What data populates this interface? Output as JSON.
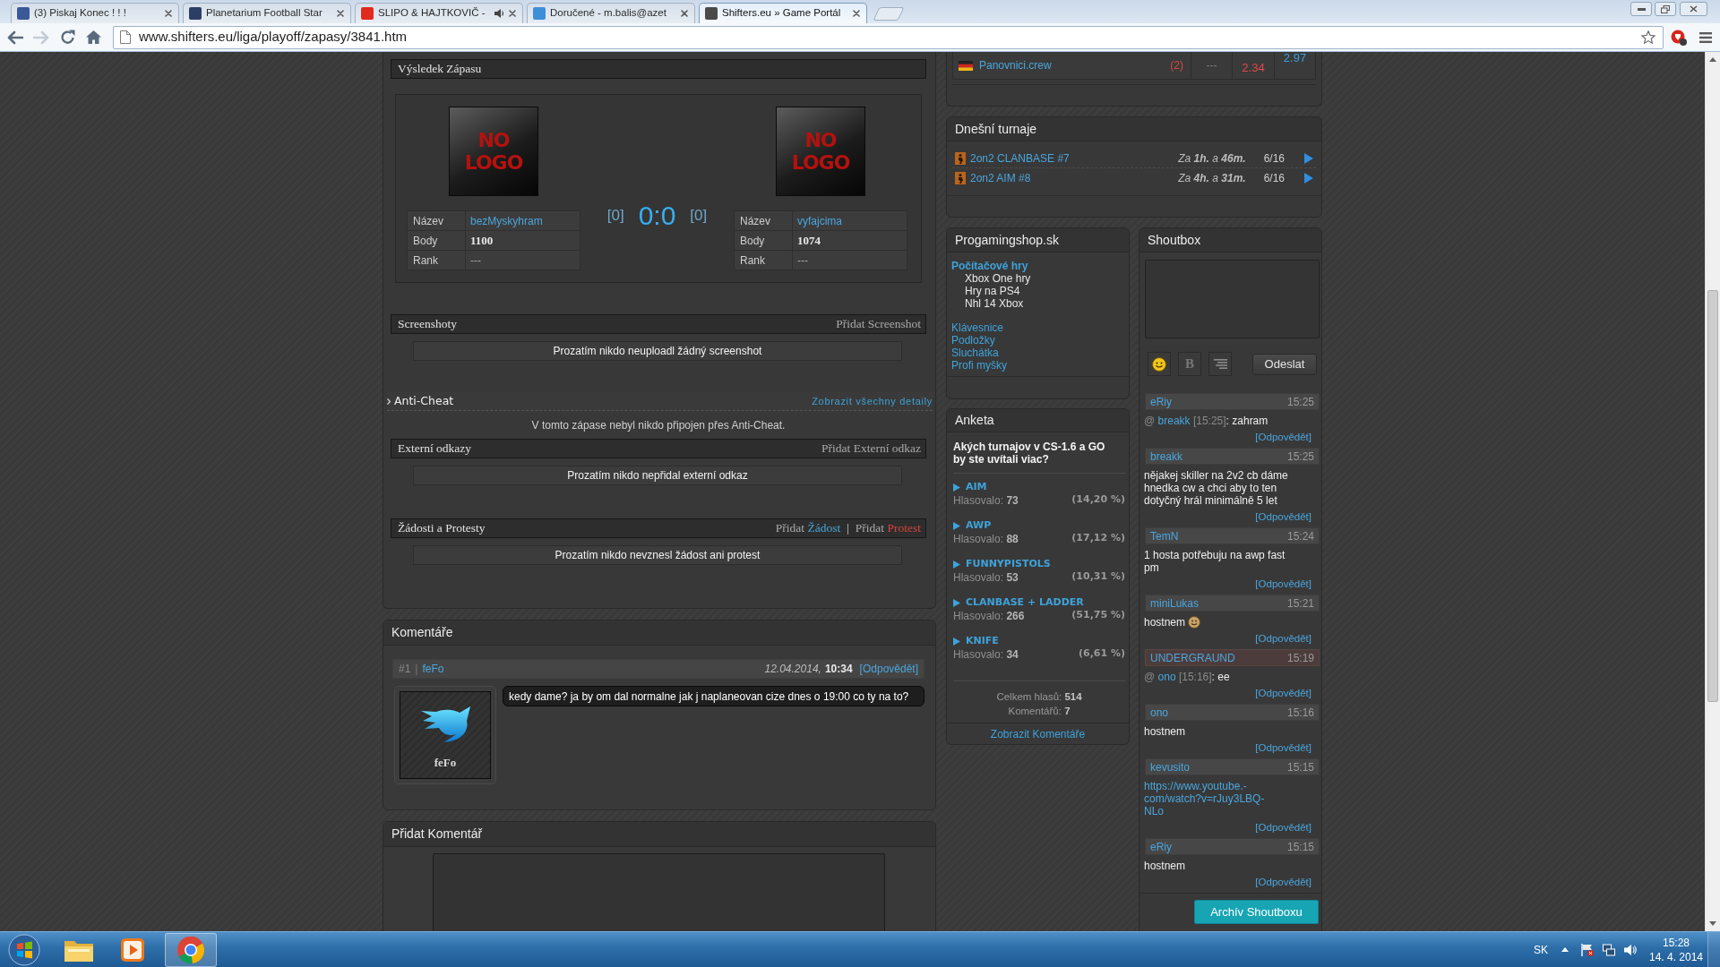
{
  "browser": {
    "tabs": [
      {
        "title": "(3) Piskaj Konec ! ! !",
        "color": "#3b5998",
        "audio": false,
        "selected": false
      },
      {
        "title": "Planetarium Football Star",
        "color": "#2c3e66",
        "audio": false,
        "selected": false
      },
      {
        "title": "SLIPO & HAJTKOVIČ -",
        "color": "#e02a20",
        "audio": true,
        "selected": false
      },
      {
        "title": "Doručené - m.balis@azet",
        "color": "#3f8fd8",
        "audio": false,
        "selected": false
      },
      {
        "title": "Shifters.eu » Game Portál",
        "color": "#4a4a4a",
        "audio": false,
        "selected": true
      }
    ],
    "can_go_forward": false,
    "address": "www.shifters.eu/liga/playoff/zapasy/3841.htm"
  },
  "standings": {
    "rows": [
      {
        "team": "Panovnici.crew",
        "column_2": "(2)",
        "column_3": "---",
        "column_4": "2.34",
        "column_5": "2.97"
      }
    ]
  },
  "match": {
    "title": "Výsledek Zápasu",
    "teams": [
      {
        "logo": "NO LOGO",
        "fields": [
          {
            "label": "Název",
            "value": "bezMyskyhram",
            "kind": "link"
          },
          {
            "label": "Body",
            "value": "1100",
            "kind": "strong"
          },
          {
            "label": "Rank",
            "value": "---",
            "kind": "plain"
          }
        ]
      },
      {
        "logo": "NO LOGO",
        "fields": [
          {
            "label": "Název",
            "value": "vyfajcima",
            "kind": "link"
          },
          {
            "label": "Body",
            "value": "1074",
            "kind": "strong"
          },
          {
            "label": "Rank",
            "value": "---",
            "kind": "plain"
          }
        ]
      }
    ],
    "score": {
      "left": "[0]",
      "main": "0:0",
      "right": "[0]"
    }
  },
  "sections": [
    {
      "kind": "section",
      "title": "Screenshoty",
      "actions": [
        {
          "verb": "Přidat",
          "object": "Screenshot",
          "color": "#a9a9a9"
        }
      ],
      "message": "Prozatím nikdo neuploadl žádný screenshot"
    },
    {
      "kind": "anticheat",
      "title": "Anti-Cheat",
      "link": "Zobrazit všechny detaily",
      "message": "V tomto zápase nebyl nikdo připojen přes Anti-Cheat."
    },
    {
      "kind": "section",
      "title": "Externí odkazy",
      "actions": [
        {
          "verb": "Přidat",
          "object": "Externí odkaz",
          "color": "#a9a9a9"
        }
      ],
      "message": "Prozatím nikdo nepřidal externí odkaz"
    },
    {
      "kind": "section",
      "title": "Žádosti a Protesty",
      "actions": [
        {
          "verb": "Přidat",
          "object": "Žádost",
          "color": "#46a6dc"
        },
        {
          "verb": "Přidat",
          "object": "Protest",
          "color": "#d8433a"
        }
      ],
      "separator": "|",
      "message": "Prozatím nikdo nevznesl žádost ani protest"
    }
  ],
  "comments": {
    "title": "Komentáře",
    "items": [
      {
        "number": "#1",
        "separator": "|",
        "author": "feFo",
        "date": "12.04.2014,",
        "time": "10:34",
        "reply": "[Odpovědět]",
        "avatar_label": "feFo",
        "text": "kedy dame? ja by om dal normalne jak j naplaneovan cize dnes o 19:00 co ty na to?"
      }
    ]
  },
  "add_comment": {
    "title": "Přidat Komentář"
  },
  "tournaments": {
    "title": "Dnešní turnaje",
    "items": [
      {
        "name": "2on2 CLANBASE #7",
        "starts": "Za **1h.** a **46m.**",
        "slots": "6/16"
      },
      {
        "name": "2on2 AIM #8",
        "starts": "Za **4h.** a **31m.**",
        "slots": "6/16"
      }
    ]
  },
  "shop": {
    "title": "Progamingshop.sk",
    "category": "Počítačové hry",
    "subitems": [
      "Xbox One hry",
      "Hry na PS4",
      "Nhl 14 Xbox"
    ],
    "links": [
      "Klávesnice",
      "Podložky",
      "Sluchátka",
      "Profi myšky"
    ]
  },
  "poll": {
    "title": "Anketa",
    "question": "Akých turnajov v CS-1.6 a GO by ste uvítali viac?",
    "options": [
      {
        "name": "AIM",
        "votes": "Hlasovalo: **73**",
        "percent": "(14,20 %)"
      },
      {
        "name": "AWP",
        "votes": "Hlasovalo: **88**",
        "percent": "(17,12 %)"
      },
      {
        "name": "FUNNYPISTOLS",
        "votes": "Hlasovalo: **53**",
        "percent": "(10,31 %)"
      },
      {
        "name": "CLANBASE + LADDER",
        "votes": "Hlasovalo: **266**",
        "percent": "(51,75 %)"
      },
      {
        "name": "KNIFE",
        "votes": "Hlasovalo: **34**",
        "percent": "(6,61 %)"
      }
    ],
    "total": "Celkem hlasů: **514**",
    "comment_count": "Komentářů: **7**",
    "footer_link": "Zobrazit Komentáře"
  },
  "shoutbox": {
    "title": "Shoutbox",
    "format_buttons": [
      {
        "kind": "emoji"
      },
      {
        "kind": "bold",
        "label": "B"
      },
      {
        "kind": "align"
      }
    ],
    "send": "Odeslat",
    "messages": [
      {
        "author": "eRiy",
        "time": "15:25",
        "highlighted": false,
        "reply_to": {
          "at": "@",
          "user": "breakk",
          "stamp": "[15:25]"
        },
        "kind": "plain",
        "text": ": zahram",
        "reply": "[Odpovědět]"
      },
      {
        "author": "breakk",
        "time": "15:25",
        "highlighted": false,
        "kind": "plain",
        "text": "nějakej skiller na 2v2 cb dáme hnedka cw a chci aby to ten dotyčný hrál minimálně 5 let",
        "reply": "[Odpovědět]"
      },
      {
        "author": "TemN",
        "time": "15:24",
        "highlighted": false,
        "kind": "plain",
        "text": "1 hosta potřebuju na awp fast pm",
        "reply": "[Odpovědět]"
      },
      {
        "author": "miniLukas",
        "time": "15:21",
        "highlighted": false,
        "kind": "plain",
        "text": "hostnem",
        "emoji": true,
        "reply": "[Odpovědět]"
      },
      {
        "author": "UNDERGRAUND",
        "time": "15:19",
        "highlighted": true,
        "reply_to": {
          "at": "@",
          "user": "ono",
          "stamp": "[15:16]"
        },
        "kind": "plain",
        "text": ": ee",
        "reply": "[Odpovědět]"
      },
      {
        "author": "ono",
        "time": "15:16",
        "highlighted": false,
        "kind": "plain",
        "text": "hostnem",
        "reply": "[Odpovědět]"
      },
      {
        "author": "kevusito",
        "time": "15:15",
        "highlighted": false,
        "kind": "url",
        "text": "https://www.youtube.-com/watch?v=rJuy3LBQ-NLo",
        "reply": "[Odpovědět]"
      },
      {
        "author": "eRiy",
        "time": "15:15",
        "highlighted": false,
        "kind": "plain",
        "text": "hostnem",
        "reply": "[Odpovědět]"
      }
    ],
    "archive": "Archív Shoutboxu"
  },
  "taskbar": {
    "items": [
      {
        "kind": "folder",
        "selected": false
      },
      {
        "kind": "media",
        "selected": false
      },
      {
        "kind": "browser",
        "selected": true
      }
    ],
    "language": "SK",
    "time": "15:28",
    "date": "14. 4. 2014"
  }
}
